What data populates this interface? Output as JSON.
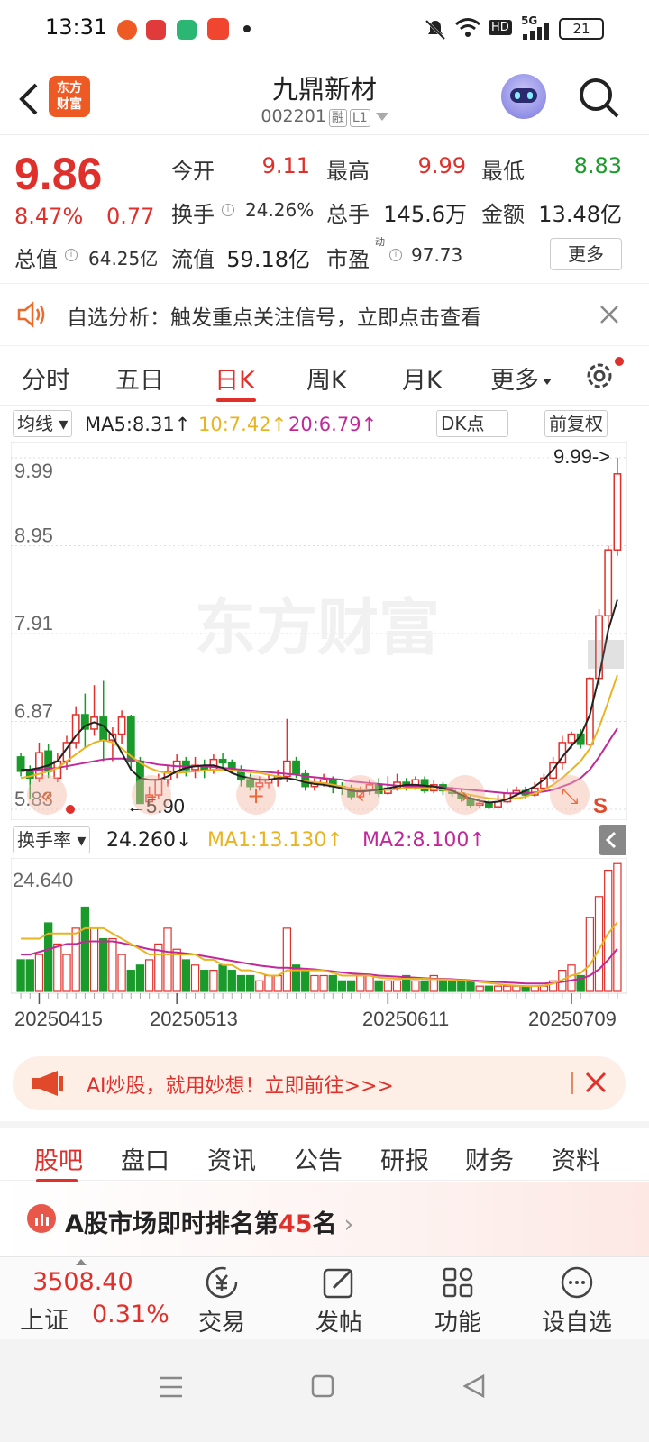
{
  "status_bar": {
    "time": "13:31",
    "network": "5G",
    "hd": "HD",
    "battery": "21"
  },
  "header": {
    "logo_text": "东方\n财富",
    "stock_name": "九鼎新材",
    "stock_code": "002201",
    "tag_margin": "融",
    "tag_level": "L1"
  },
  "quote": {
    "price": "9.86",
    "change_pct": "8.47%",
    "change": "0.77",
    "open_label": "今开",
    "open": "9.11",
    "high_label": "最高",
    "high": "9.99",
    "low_label": "最低",
    "low": "8.83",
    "turnover_label": "换手",
    "turnover": "24.26%",
    "volume_label": "总手",
    "volume": "145.6万",
    "amount_label": "金额",
    "amount": "13.48亿",
    "mktcap_label": "总值",
    "mktcap": "64.25亿",
    "float_label": "流值",
    "float": "59.18亿",
    "pe_label": "市盈",
    "pe_sup": "动",
    "pe": "97.73",
    "more_label": "更多"
  },
  "alert": {
    "text": "自选分析：触发重点关注信号，立即点击查看"
  },
  "k_tabs": [
    "分时",
    "五日",
    "日K",
    "周K",
    "月K",
    "更多"
  ],
  "ma_legend": {
    "selector": "均线",
    "ma5": "MA5:8.31",
    "ma10": "10:7.42",
    "ma20": "20:6.79",
    "dk": "DK点",
    "adjust": "前复权"
  },
  "colors": {
    "up": "#e0302b",
    "down": "#1a9a2a",
    "ma5": "#222222",
    "ma10": "#e8b422",
    "ma20": "#c0299a",
    "accent": "#e0302b"
  },
  "chart_data": [
    {
      "type": "candlestick",
      "title": "",
      "y_tick_labels": [
        "9.99",
        "8.95",
        "7.91",
        "6.87",
        "5.83"
      ],
      "ylim": [
        5.83,
        9.99
      ],
      "max_label": "9.99->",
      "min_label": "5.90",
      "watermark": "东方财富",
      "marker_s": "S",
      "candles": [
        [
          6.45,
          6.28,
          6.5,
          6.22
        ],
        [
          6.28,
          6.2,
          6.35,
          5.95
        ],
        [
          6.2,
          6.5,
          6.62,
          6.15
        ],
        [
          6.52,
          6.28,
          6.6,
          6.2
        ],
        [
          6.2,
          6.4,
          6.5,
          6.15
        ],
        [
          6.4,
          6.62,
          6.7,
          6.3
        ],
        [
          6.62,
          6.95,
          7.05,
          6.55
        ],
        [
          6.95,
          6.78,
          7.2,
          6.55
        ],
        [
          6.78,
          6.92,
          7.3,
          6.7
        ],
        [
          6.92,
          6.65,
          7.35,
          6.4
        ],
        [
          6.65,
          6.72,
          6.8,
          6.4
        ],
        [
          6.72,
          6.92,
          7.0,
          6.6
        ],
        [
          6.92,
          6.4,
          6.95,
          6.3
        ],
        [
          6.4,
          5.9,
          6.45,
          5.9
        ],
        [
          5.92,
          6.0,
          6.1,
          5.88
        ],
        [
          6.0,
          6.18,
          6.25,
          5.95
        ],
        [
          6.18,
          6.28,
          6.35,
          6.1
        ],
        [
          6.28,
          6.4,
          6.48,
          6.2
        ],
        [
          6.4,
          6.3,
          6.45,
          6.22
        ],
        [
          6.3,
          6.35,
          6.45,
          6.2
        ],
        [
          6.35,
          6.3,
          6.42,
          6.2
        ],
        [
          6.3,
          6.42,
          6.48,
          6.25
        ],
        [
          6.42,
          6.38,
          6.5,
          6.3
        ],
        [
          6.38,
          6.3,
          6.42,
          6.25
        ],
        [
          6.3,
          6.18,
          6.35,
          6.1
        ],
        [
          6.18,
          6.1,
          6.25,
          6.05
        ],
        [
          6.1,
          6.14,
          6.22,
          6.05
        ],
        [
          6.14,
          6.18,
          6.25,
          6.08
        ],
        [
          6.18,
          6.22,
          6.3,
          6.1
        ],
        [
          6.22,
          6.4,
          6.9,
          6.15
        ],
        [
          6.4,
          6.25,
          6.45,
          6.2
        ],
        [
          6.25,
          6.1,
          6.3,
          6.05
        ],
        [
          6.1,
          6.14,
          6.2,
          6.05
        ],
        [
          6.14,
          6.18,
          6.25,
          6.1
        ],
        [
          6.18,
          6.1,
          6.22,
          6.02
        ],
        [
          6.1,
          6.08,
          6.15,
          6.0
        ],
        [
          6.08,
          5.98,
          6.12,
          5.94
        ],
        [
          5.98,
          6.05,
          6.1,
          5.95
        ],
        [
          6.05,
          6.12,
          6.18,
          6.0
        ],
        [
          6.12,
          6.02,
          6.2,
          5.98
        ],
        [
          6.02,
          6.08,
          6.22,
          6.0
        ],
        [
          6.08,
          6.15,
          6.25,
          6.05
        ],
        [
          6.15,
          6.1,
          6.2,
          6.05
        ],
        [
          6.1,
          6.18,
          6.22,
          6.06
        ],
        [
          6.18,
          6.05,
          6.22,
          6.02
        ],
        [
          6.05,
          6.12,
          6.18,
          6.02
        ],
        [
          6.12,
          6.05,
          6.15,
          6.0
        ],
        [
          6.05,
          6.02,
          6.1,
          5.98
        ],
        [
          6.02,
          5.96,
          6.08,
          5.92
        ],
        [
          5.96,
          5.88,
          6.0,
          5.84
        ],
        [
          5.88,
          5.9,
          5.96,
          5.84
        ],
        [
          5.9,
          5.86,
          5.94,
          5.83
        ],
        [
          5.86,
          5.92,
          6.0,
          5.84
        ],
        [
          5.92,
          6.02,
          6.08,
          5.9
        ],
        [
          6.02,
          6.05,
          6.1,
          5.98
        ],
        [
          6.05,
          6.0,
          6.1,
          5.96
        ],
        [
          6.0,
          6.08,
          6.15,
          5.98
        ],
        [
          6.08,
          6.2,
          6.25,
          6.05
        ],
        [
          6.2,
          6.38,
          6.45,
          6.15
        ],
        [
          6.38,
          6.62,
          6.7,
          6.3
        ],
        [
          6.62,
          6.72,
          6.75,
          6.55
        ],
        [
          6.72,
          6.6,
          6.78,
          6.55
        ],
        [
          6.6,
          7.38,
          7.4,
          6.58
        ],
        [
          7.38,
          8.12,
          8.2,
          7.3
        ],
        [
          8.12,
          8.9,
          8.95,
          8.0
        ],
        [
          8.9,
          9.8,
          9.99,
          8.83
        ]
      ],
      "ma5": [
        6.3,
        6.3,
        6.32,
        6.35,
        6.4,
        6.55,
        6.7,
        6.82,
        6.86,
        6.82,
        6.7,
        6.5,
        6.3,
        6.2,
        6.18,
        6.18,
        6.22,
        6.28,
        6.32,
        6.34,
        6.35,
        6.35,
        6.32,
        6.26,
        6.22,
        6.2,
        6.18,
        6.18,
        6.2,
        6.2,
        6.18,
        6.15,
        6.13,
        6.12,
        6.1,
        6.08,
        6.05,
        6.04,
        6.05,
        6.06,
        6.08,
        6.1,
        6.12,
        6.12,
        6.11,
        6.1,
        6.08,
        6.05,
        6.0,
        5.96,
        5.93,
        5.91,
        5.92,
        5.95,
        6.0,
        6.05,
        6.1,
        6.18,
        6.3,
        6.45,
        6.58,
        6.7,
        6.95,
        7.4,
        7.95,
        8.31
      ],
      "ma10": [
        6.2,
        6.22,
        6.25,
        6.28,
        6.32,
        6.4,
        6.48,
        6.56,
        6.62,
        6.65,
        6.62,
        6.55,
        6.46,
        6.38,
        6.32,
        6.28,
        6.26,
        6.26,
        6.27,
        6.28,
        6.29,
        6.3,
        6.3,
        6.29,
        6.28,
        6.27,
        6.26,
        6.24,
        6.22,
        6.2,
        6.18,
        6.16,
        6.15,
        6.14,
        6.12,
        6.1,
        6.08,
        6.07,
        6.06,
        6.06,
        6.06,
        6.07,
        6.08,
        6.08,
        6.08,
        6.07,
        6.06,
        6.04,
        6.02,
        6.0,
        5.98,
        5.96,
        5.95,
        5.95,
        5.96,
        5.98,
        6.02,
        6.06,
        6.12,
        6.2,
        6.3,
        6.4,
        6.55,
        6.8,
        7.1,
        7.42
      ],
      "ma20": [
        6.3,
        6.3,
        6.3,
        6.31,
        6.32,
        6.34,
        6.36,
        6.38,
        6.4,
        6.42,
        6.43,
        6.43,
        6.42,
        6.4,
        6.38,
        6.36,
        6.35,
        6.34,
        6.34,
        6.34,
        6.34,
        6.33,
        6.32,
        6.31,
        6.3,
        6.29,
        6.28,
        6.27,
        6.26,
        6.25,
        6.24,
        6.22,
        6.21,
        6.2,
        6.19,
        6.18,
        6.16,
        6.15,
        6.14,
        6.13,
        6.12,
        6.11,
        6.1,
        6.1,
        6.1,
        6.1,
        6.09,
        6.08,
        6.07,
        6.06,
        6.05,
        6.04,
        6.03,
        6.02,
        6.02,
        6.02,
        6.03,
        6.04,
        6.06,
        6.1,
        6.14,
        6.2,
        6.3,
        6.45,
        6.62,
        6.79
      ]
    },
    {
      "type": "bar",
      "title": "换手率",
      "y_tick_labels": [
        "24.640"
      ],
      "ylim": [
        0,
        24.64
      ],
      "x_tick_labels": [
        "20250415",
        "20250513",
        "20250611",
        "20250709"
      ],
      "values": [
        6,
        6,
        7,
        13,
        9,
        7,
        12,
        16,
        12,
        10,
        10,
        7,
        4,
        5,
        6,
        9,
        12,
        8,
        6,
        5,
        4,
        4,
        5,
        4,
        3,
        3,
        2,
        3,
        3,
        12,
        5,
        4,
        3,
        3,
        3,
        2,
        2,
        3,
        3,
        2,
        2,
        2,
        3,
        2,
        2,
        3,
        2,
        2,
        2,
        2,
        1,
        1,
        1,
        1,
        1,
        1,
        1,
        1,
        2,
        4,
        5,
        3,
        14,
        18,
        23,
        24.26
      ],
      "ma1": [
        10,
        10,
        10,
        11,
        11,
        11,
        11,
        12,
        12,
        12,
        11,
        10,
        9,
        8,
        7,
        7,
        7,
        7,
        7,
        7,
        6,
        6,
        5,
        5,
        4,
        4,
        3.5,
        3,
        3,
        4,
        4,
        4,
        4,
        4,
        3.5,
        3,
        3,
        3,
        3,
        2.6,
        2.5,
        2.4,
        2.4,
        2.4,
        2.4,
        2.3,
        2.3,
        2.2,
        2.1,
        2,
        1.8,
        1.6,
        1.4,
        1.2,
        1.1,
        1,
        1,
        1.1,
        1.5,
        2.2,
        3,
        3.5,
        5,
        8,
        11,
        13.13
      ],
      "ma2": [
        7,
        7,
        7.5,
        8,
        8.5,
        9,
        9,
        9.5,
        9.5,
        9.5,
        9.5,
        9.2,
        8.8,
        8.4,
        8,
        7.8,
        7.5,
        7.4,
        7.2,
        7,
        6.7,
        6.4,
        6.1,
        5.8,
        5.5,
        5.2,
        4.9,
        4.7,
        4.5,
        4.5,
        4.4,
        4.3,
        4.2,
        4,
        3.8,
        3.6,
        3.4,
        3.3,
        3.2,
        3,
        2.9,
        2.8,
        2.7,
        2.6,
        2.5,
        2.4,
        2.4,
        2.3,
        2.2,
        2.1,
        2,
        1.9,
        1.8,
        1.7,
        1.6,
        1.5,
        1.5,
        1.5,
        1.6,
        1.8,
        2.1,
        2.4,
        3,
        4.2,
        6,
        8.1
      ]
    }
  ],
  "vol_legend": {
    "selector": "换手率",
    "value": "24.260",
    "ma1": "MA1:13.130",
    "ma2": "MA2:8.100"
  },
  "ai_banner": {
    "text": "AI炒股，就用妙想！立即前往>>>"
  },
  "bottom_tabs": [
    "股吧",
    "盘口",
    "资讯",
    "公告",
    "研报",
    "财务",
    "资料"
  ],
  "rank": {
    "prefix": "A股市场即时排名第",
    "rank_no": "45",
    "suffix": "名"
  },
  "bottom_nav": {
    "index_value": "3508.40",
    "index_name": "上证",
    "index_change": "0.31%",
    "items": [
      "交易",
      "发帖",
      "功能",
      "设自选"
    ]
  }
}
